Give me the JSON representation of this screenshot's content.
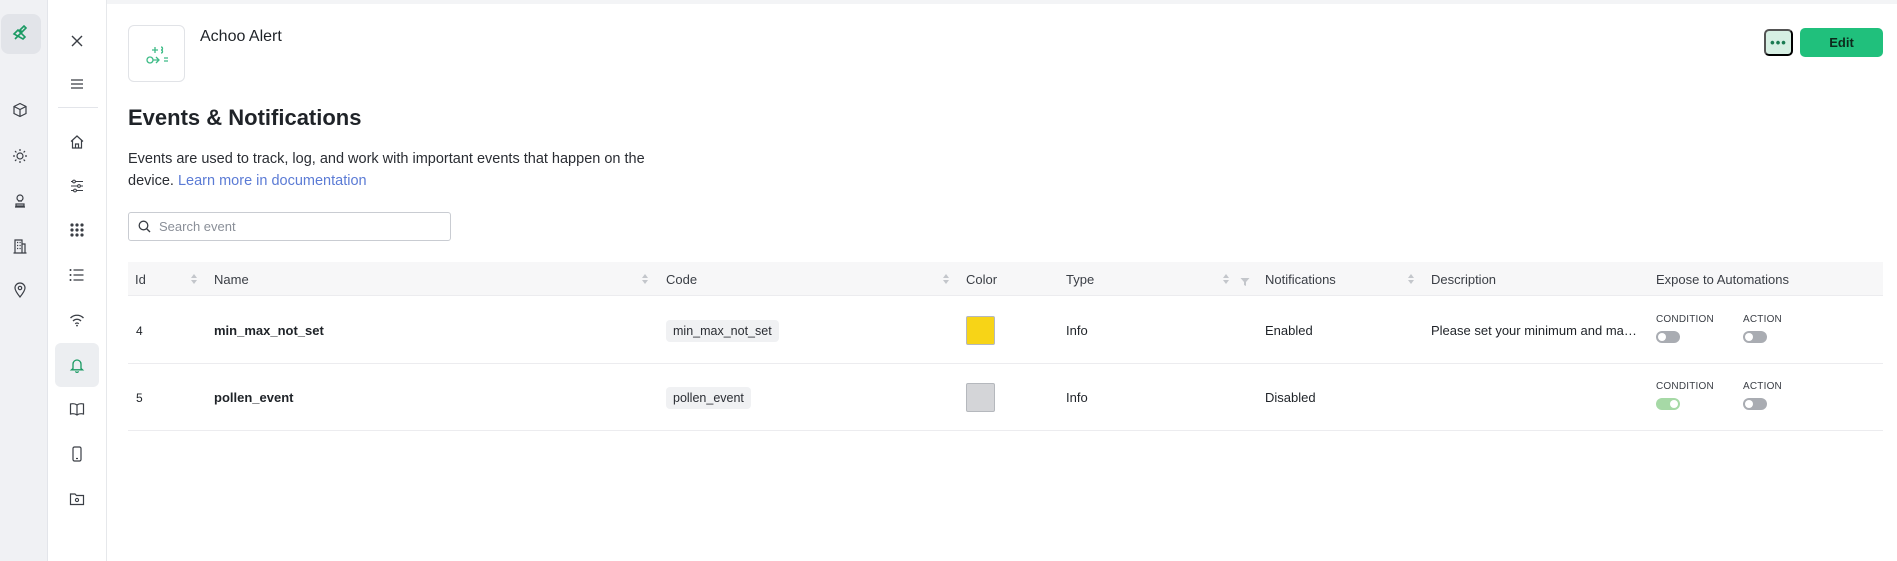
{
  "device": {
    "name": "Achoo Alert"
  },
  "header": {
    "more_label": "•••",
    "edit_label": "Edit"
  },
  "page": {
    "title": "Events & Notifications",
    "description": "Events are used to track, log, and work with important events that happen on the device.",
    "doc_link": "Learn more in documentation"
  },
  "search": {
    "placeholder": "Search event",
    "value": ""
  },
  "table": {
    "columns": {
      "id": "Id",
      "name": "Name",
      "code": "Code",
      "color": "Color",
      "type": "Type",
      "notifications": "Notifications",
      "description": "Description",
      "expose": "Expose to Automations"
    },
    "rows": [
      {
        "id": "4",
        "name": "min_max_not_set",
        "code": "min_max_not_set",
        "color": "#f7d417",
        "type": "Info",
        "notifications": "Enabled",
        "description": "Please set your minimum and maxi...",
        "condition_label": "CONDITION",
        "action_label": "ACTION",
        "condition_on": false,
        "action_on": false
      },
      {
        "id": "5",
        "name": "pollen_event",
        "code": "pollen_event",
        "color": "#d4d5d8",
        "type": "Info",
        "notifications": "Disabled",
        "description": "",
        "condition_label": "CONDITION",
        "action_label": "ACTION",
        "condition_on": true,
        "action_on": false
      }
    ]
  },
  "colors": {
    "accent": "#20c07c",
    "link": "#5b7bd5",
    "active_nav": "#1a9a63"
  },
  "icons": {
    "rail": [
      "tools-icon",
      "cube-icon",
      "sun-icon",
      "stamp-icon",
      "building-icon",
      "map-pin-icon"
    ],
    "sidebar": [
      "close-icon",
      "menu-icon",
      "home-icon",
      "sliders-icon",
      "grid-icon",
      "list-icon",
      "wifi-icon",
      "bell-icon",
      "book-icon",
      "phone-icon",
      "folder-icon"
    ]
  }
}
